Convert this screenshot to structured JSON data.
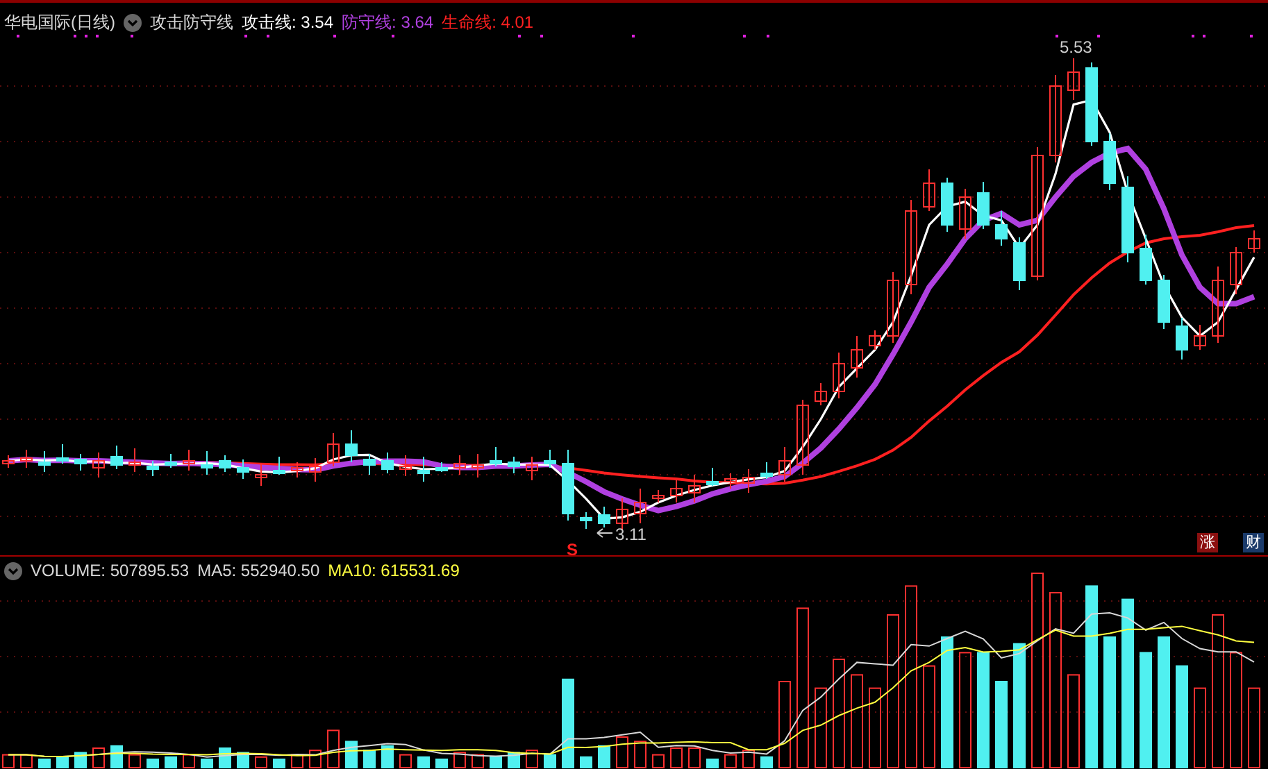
{
  "price_panel": {
    "title": "华电国际(日线)",
    "indicator": "攻击防守线",
    "lines": [
      {
        "label": "攻击线: 3.54",
        "color": "#ffffff"
      },
      {
        "label": "防守线: 3.64",
        "color": "#b040e0"
      },
      {
        "label": "生命线: 4.01",
        "color": "#ff2020"
      }
    ],
    "high_label": "5.53",
    "low_label": "3.11",
    "signal": "S",
    "badges": [
      {
        "text": "涨",
        "color": "#8b1010"
      },
      {
        "text": "财",
        "color": "#1a3a6a"
      }
    ]
  },
  "volume_panel": {
    "lines": [
      {
        "label": "VOLUME: 507895.53",
        "color": "#d8d8d8"
      },
      {
        "label": "MA5: 552940.50",
        "color": "#d8d8d8"
      },
      {
        "label": "MA10: 615531.69",
        "color": "#ffff40"
      }
    ]
  }
}
